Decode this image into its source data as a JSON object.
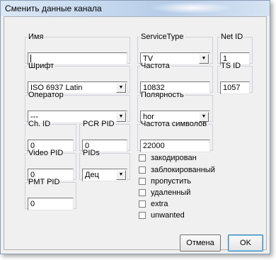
{
  "window": {
    "title": "Сменить данные канала"
  },
  "fields": {
    "name": {
      "label": "Имя",
      "value": ""
    },
    "service_type": {
      "label": "ServiceType",
      "value": "TV"
    },
    "net_id": {
      "label": "Net ID",
      "value": "1"
    },
    "font": {
      "label": "Шрифт",
      "value": "ISO 6937 Latin"
    },
    "frequency": {
      "label": "Частота",
      "value": "10832"
    },
    "ts_id": {
      "label": "TS ID",
      "value": "1057"
    },
    "operator": {
      "label": "Оператор",
      "value": "---"
    },
    "polarity": {
      "label": "Полярность",
      "value": "hor"
    },
    "ch_id": {
      "label": "Ch. ID",
      "value": "0"
    },
    "pcr_pid": {
      "label": "PCR PID",
      "value": "0"
    },
    "symbol_rate": {
      "label": "Частота символов",
      "value": "22000"
    },
    "video_pid": {
      "label": "Video PID",
      "value": "0"
    },
    "pids": {
      "label": "PIDs",
      "value": "Дец"
    },
    "pmt_pid": {
      "label": "PMT PID",
      "value": "0"
    }
  },
  "checkboxes": [
    {
      "label": "закодирован",
      "checked": false
    },
    {
      "label": "заблокированный",
      "checked": false
    },
    {
      "label": "пропустить",
      "checked": false
    },
    {
      "label": "удаленный",
      "checked": false
    },
    {
      "label": "extra",
      "checked": false
    },
    {
      "label": "unwanted",
      "checked": false
    }
  ],
  "buttons": {
    "cancel": "Отмена",
    "ok": "OK"
  }
}
